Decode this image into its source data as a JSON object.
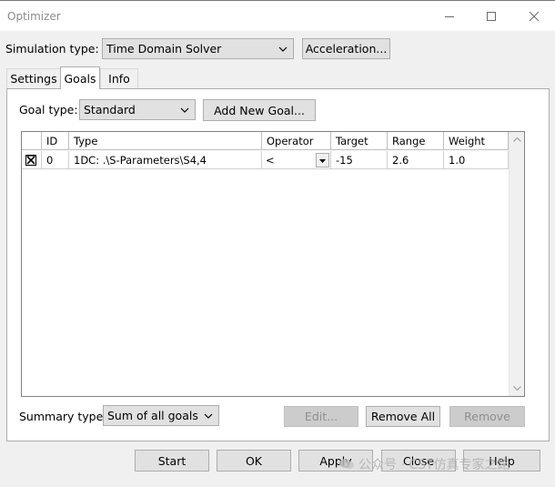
{
  "window": {
    "title": "Optimizer"
  },
  "simulation": {
    "label": "Simulation type:",
    "value": "Time Domain Solver",
    "acceleration_label": "Acceleration..."
  },
  "tabs": [
    {
      "label": "Settings"
    },
    {
      "label": "Goals"
    },
    {
      "label": "Info"
    }
  ],
  "goal_type": {
    "label": "Goal type:",
    "value": "Standard",
    "add_label": "Add New Goal..."
  },
  "grid": {
    "columns": [
      "ID",
      "Type",
      "Operator",
      "Target",
      "Range",
      "Weight"
    ],
    "rows": [
      {
        "checked": true,
        "id": "0",
        "type": "1DC: .\\S-Parameters\\S4,4",
        "operator": "<",
        "target": "-15",
        "range": "2.6",
        "weight": "1.0"
      }
    ]
  },
  "summary": {
    "label": "Summary type:",
    "value": "Sum of all goals",
    "edit_label": "Edit...",
    "remove_all_label": "Remove All",
    "remove_label": "Remove"
  },
  "footer": {
    "start_label": "Start",
    "ok_label": "OK",
    "apply_label": "Apply",
    "close_label": "Close",
    "help_label": "Help"
  },
  "watermark": {
    "text": "公众号 · CST仿真专家之路"
  },
  "colors": {
    "disabled_bg": "#cccccc",
    "button_bg": "#e1e1e1",
    "border": "#adadad"
  }
}
